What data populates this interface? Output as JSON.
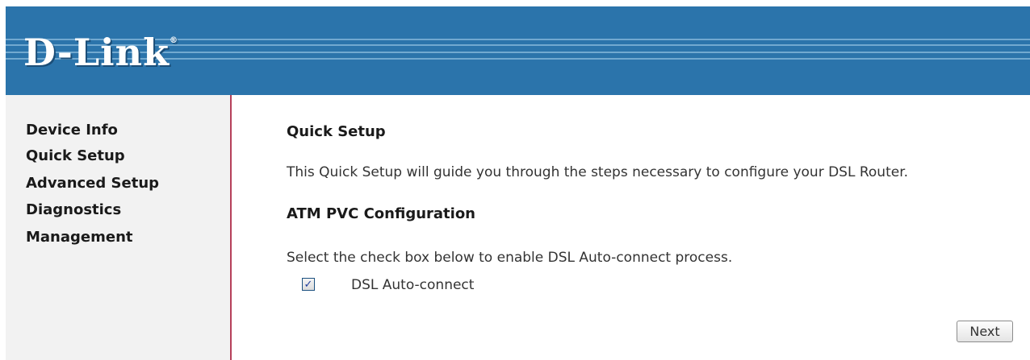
{
  "brand": {
    "logo": "D-Link",
    "reg_mark": "®"
  },
  "sidebar": {
    "items": [
      {
        "label": "Device Info"
      },
      {
        "label": "Quick Setup"
      },
      {
        "label": "Advanced Setup"
      },
      {
        "label": "Diagnostics"
      },
      {
        "label": "Management"
      }
    ]
  },
  "main": {
    "title": "Quick Setup",
    "description": "This Quick Setup will guide you through the steps necessary to configure your DSL Router.",
    "subtitle": "ATM PVC Configuration",
    "instruction": "Select the check box below to enable DSL Auto-connect process.",
    "checkbox": {
      "label": "DSL Auto-connect",
      "checked": true
    },
    "next_label": "Next"
  },
  "colors": {
    "header": "#2b74ab",
    "sidebar_bg": "#f2f2f2",
    "divider": "#b5405a"
  }
}
